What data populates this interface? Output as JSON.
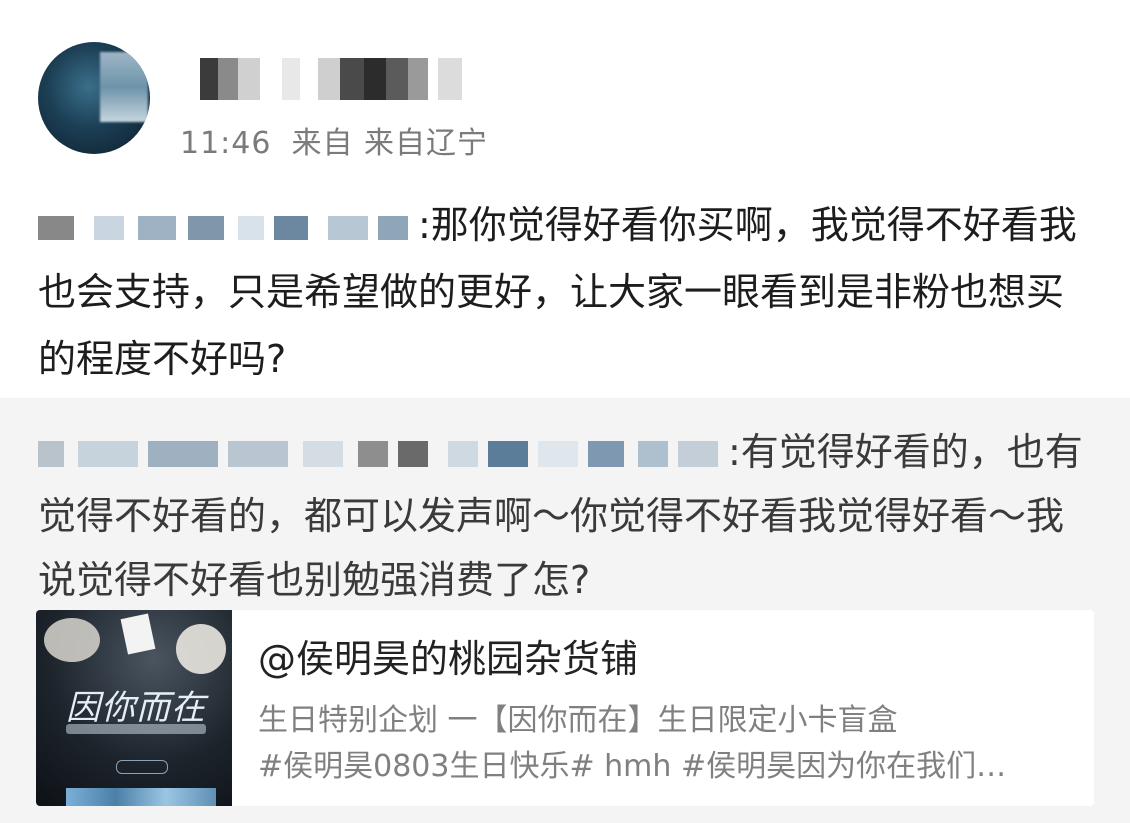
{
  "post": {
    "time": "11:46",
    "source": "来自 来自辽宁",
    "text": ":那你觉得好看你买啊，我觉得不好看我也会支持，只是希望做的更好，让大家一眼看到是非粉也想买的程度不好吗?"
  },
  "repost": {
    "text": ":有觉得好看的，也有觉得不好看的，都可以发声啊～你觉得不好看我觉得好看～我说觉得不好看也别勉强消费了怎?"
  },
  "card": {
    "title": "@侯明昊的桃园杂货铺",
    "desc_line1": "生日特别企划 一【因你而在】生日限定小卡盲盒",
    "desc_line2": "#侯明昊0803生日快乐# hmh #侯明昊因为你在我们…",
    "thumb_art_text": "因你而在"
  }
}
